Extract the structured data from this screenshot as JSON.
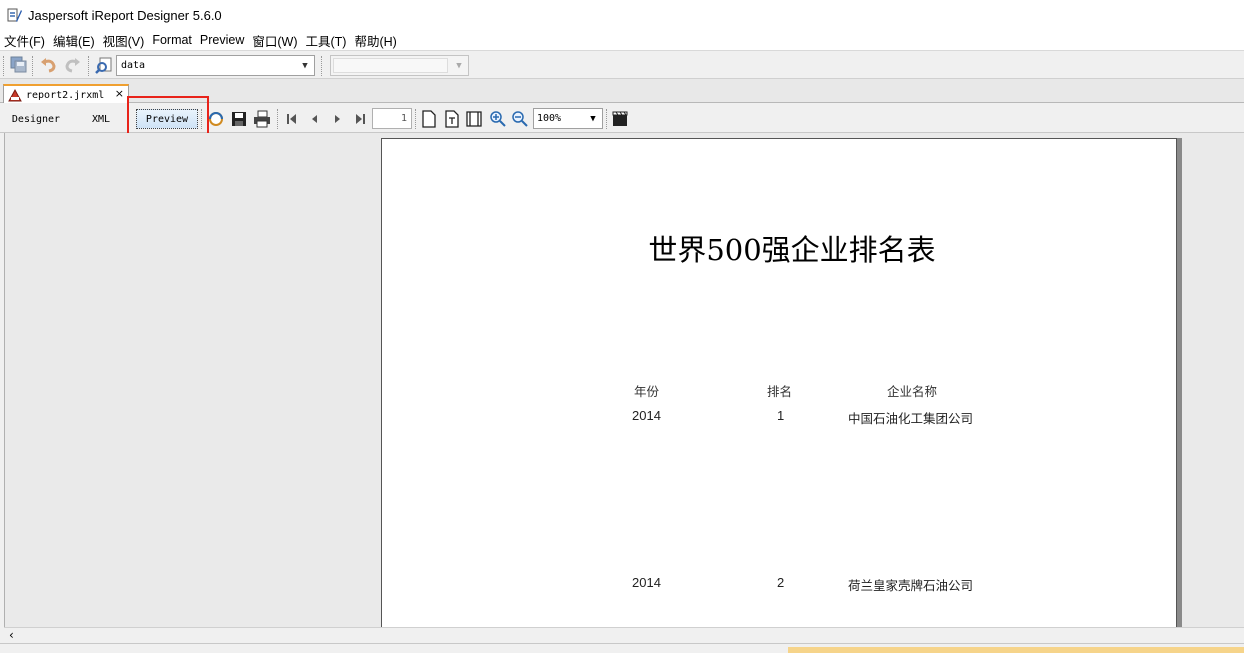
{
  "window": {
    "title": "Jaspersoft iReport Designer 5.6.0"
  },
  "menu": [
    "文件(F)",
    "编辑(E)",
    "视图(V)",
    "Format",
    "Preview",
    "窗口(W)",
    "工具(T)",
    "帮助(H)"
  ],
  "toolbar": {
    "datasource_value": "data",
    "second_combo_value": ""
  },
  "document_tab": {
    "label": "report2.jrxml",
    "close": "×"
  },
  "modes": {
    "designer": "Designer",
    "xml": "XML",
    "preview": "Preview"
  },
  "preview_toolbar": {
    "page_number": "1",
    "zoom": "100%"
  },
  "report": {
    "title": "世界500强企业排名表",
    "columns": [
      "年份",
      "排名",
      "企业名称"
    ],
    "rows": [
      {
        "year": "2014",
        "rank": "1",
        "company": "中国石油化工集团公司"
      },
      {
        "year": "2014",
        "rank": "2",
        "company": "荷兰皇家壳牌石油公司"
      }
    ]
  },
  "colors": {
    "highlight_box": "#e8231a",
    "tab_accent": "#f0a030"
  },
  "icons": [
    "app-icon",
    "save-all-icon",
    "undo-icon",
    "redo-icon",
    "preview-icon",
    "report-file-icon",
    "refresh-icon",
    "save-icon",
    "print-icon",
    "first-page-icon",
    "previous-page-icon",
    "next-page-icon",
    "last-page-icon",
    "actual-size-icon",
    "fit-page-icon",
    "fit-width-icon",
    "zoom-in-icon",
    "zoom-out-icon",
    "film-icon"
  ]
}
